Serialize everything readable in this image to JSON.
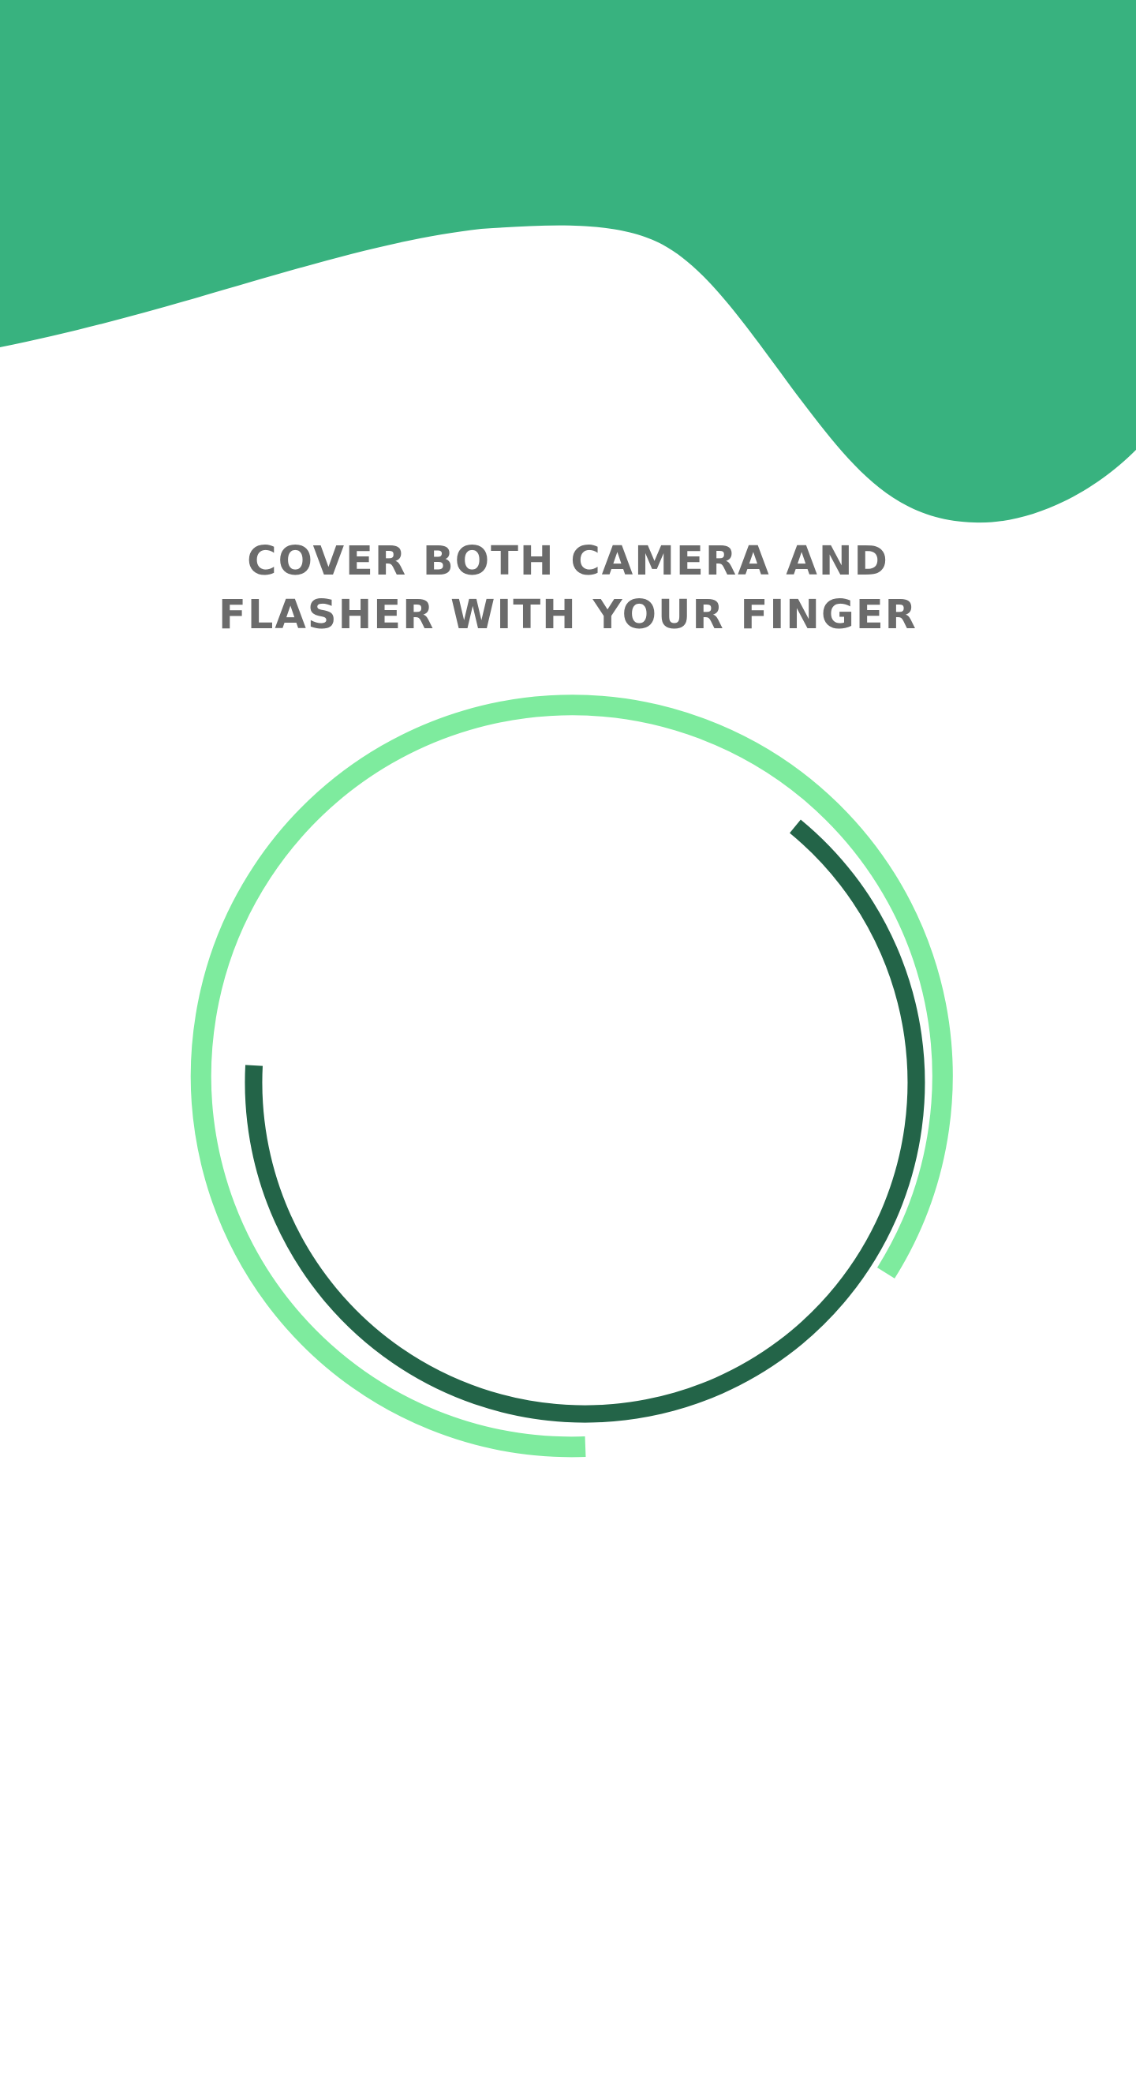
{
  "screen": {
    "instruction_line1": "COVER BOTH CAMERA AND",
    "instruction_line2": "FLASHER WITH YOUR FINGER"
  },
  "colors": {
    "header_green": "#38b27f",
    "outer_ring": "#7eeb9e",
    "inner_ring": "#236448",
    "text": "#6b6b6b"
  }
}
